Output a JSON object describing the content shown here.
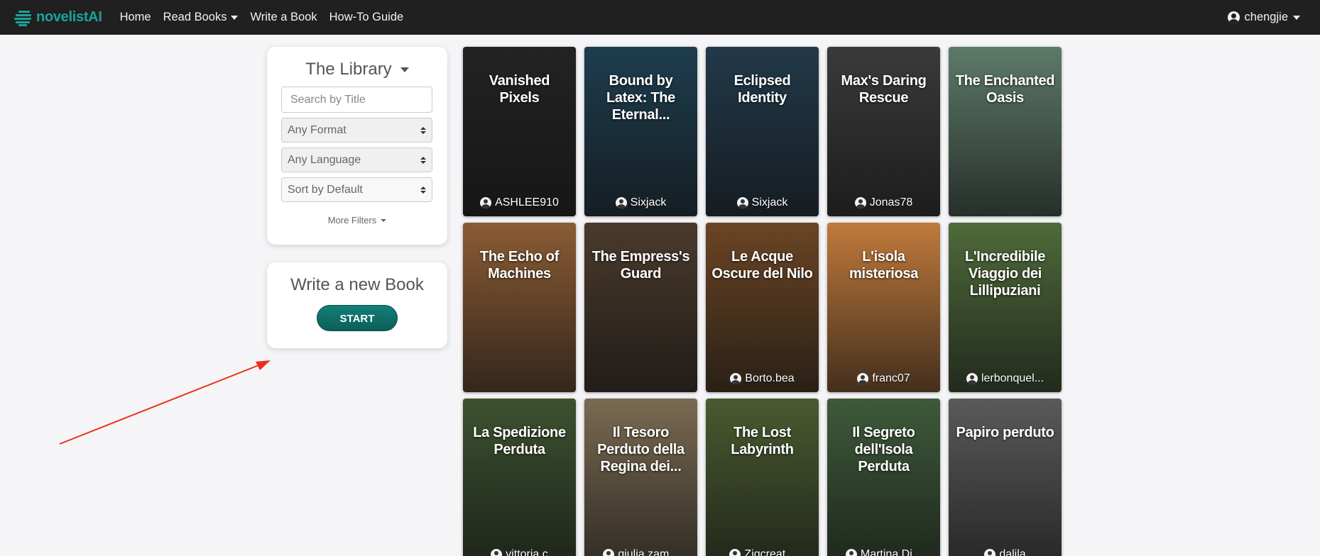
{
  "nav": {
    "brand": "novelistAI",
    "links": [
      {
        "label": "Home"
      },
      {
        "label": "Read Books",
        "dropdown": true
      },
      {
        "label": "Write a Book"
      },
      {
        "label": "How-To Guide"
      }
    ],
    "user": "chengjie"
  },
  "library": {
    "title": "The Library",
    "search_placeholder": "Search by Title",
    "format": "Any Format",
    "language": "Any Language",
    "sort": "Sort by Default",
    "more_filters": "More Filters"
  },
  "write": {
    "title": "Write a new Book",
    "start_label": "START"
  },
  "books": [
    {
      "title": "Vanished Pixels",
      "author": "ASHLEE910",
      "bg": "#232323"
    },
    {
      "title": "Bound by Latex: The Eternal...",
      "author": "Sixjack",
      "bg": "#1e3d4f"
    },
    {
      "title": "Eclipsed Identity",
      "author": "Sixjack",
      "bg": "#22394a"
    },
    {
      "title": "Max's Daring Rescue",
      "author": "Jonas78",
      "bg": "#3a3a3a"
    },
    {
      "title": "The Enchanted Oasis",
      "author": "",
      "bg": "#5d7a6a"
    },
    {
      "title": "The Echo of Machines",
      "author": "",
      "bg": "#8a5c34"
    },
    {
      "title": "The Empress's Guard",
      "author": "",
      "bg": "#4a3a2c"
    },
    {
      "title": "Le Acque Oscure del Nilo",
      "author": "Borto.bea",
      "bg": "#6a4524"
    },
    {
      "title": "L'isola misteriosa",
      "author": "franc07",
      "bg": "#c07a3c"
    },
    {
      "title": "L'Incredibile Viaggio dei Lillipuziani",
      "author": "lerbonquel...",
      "bg": "#4e6a3a"
    },
    {
      "title": "La Spedizione Perduta",
      "author": "vittoria.c",
      "bg": "#3c5230"
    },
    {
      "title": "Il Tesoro Perduto della Regina dei...",
      "author": "giulia.zam...",
      "bg": "#7a6a52"
    },
    {
      "title": "The Lost Labyrinth",
      "author": "Ziqcreat...",
      "bg": "#4a5a30"
    },
    {
      "title": "Il Segreto dell'Isola Perduta",
      "author": "Martina.Di...",
      "bg": "#3e5a3a"
    },
    {
      "title": "Papiro perduto",
      "author": "dalila",
      "bg": "#5a5a5a"
    }
  ],
  "colors": {
    "brand": "#1aa39a",
    "navbar": "#202020",
    "start_button": "#0f6e68",
    "annotation_arrow": "#e8301c"
  }
}
